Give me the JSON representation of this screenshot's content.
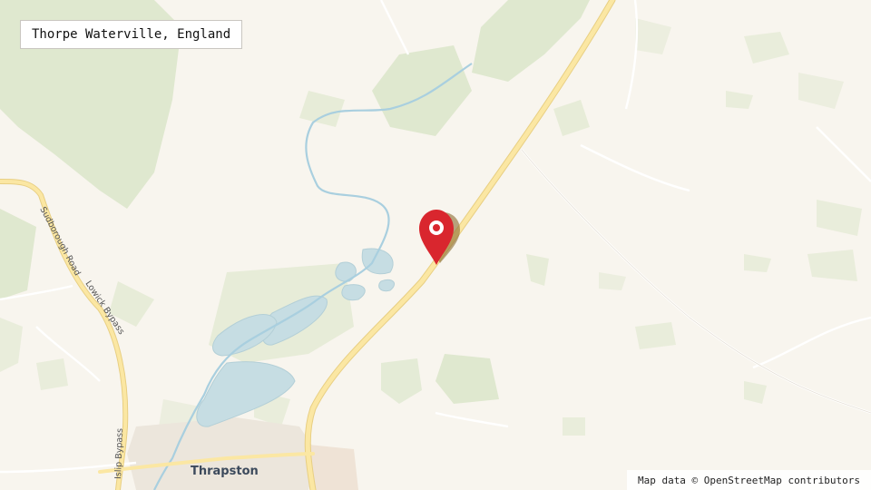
{
  "header": {
    "location_title": "Thorpe Waterville, England"
  },
  "map": {
    "place_labels": {
      "thrapston": "Thrapston"
    },
    "road_labels": {
      "sudborough": "Sudborough Road",
      "lowick": "Lowick Bypass",
      "islip": "Islip Bypass"
    },
    "marker": {
      "icon": "map-pin-icon",
      "color": "#d9262e"
    }
  },
  "footer": {
    "attribution": "Map data © OpenStreetMap contributors"
  }
}
